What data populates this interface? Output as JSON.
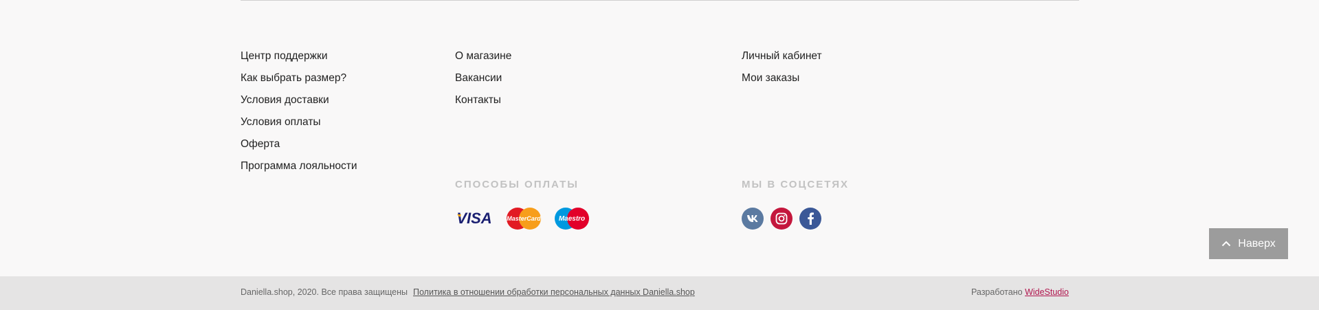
{
  "footer": {
    "column1": [
      {
        "label": "Центр поддержки"
      },
      {
        "label": "Как выбрать размер?"
      },
      {
        "label": "Условия доставки"
      },
      {
        "label": "Условия оплаты"
      },
      {
        "label": "Оферта"
      },
      {
        "label": "Программа лояльности"
      }
    ],
    "column2": [
      {
        "label": "О магазине"
      },
      {
        "label": "Вакансии"
      },
      {
        "label": "Контакты"
      }
    ],
    "column3": [
      {
        "label": "Личный кабинет"
      },
      {
        "label": "Мои заказы"
      }
    ],
    "payments": {
      "title": "СПОСОБЫ ОПЛАТЫ",
      "logos": [
        {
          "icon": "visa-logo",
          "text": "VISA"
        },
        {
          "icon": "mastercard-logo",
          "text": "MasterCard"
        },
        {
          "icon": "maestro-logo",
          "text": "Maestro"
        }
      ]
    },
    "social": {
      "title": "МЫ В СОЦСЕТЯХ",
      "items": [
        {
          "icon": "vk-icon",
          "color": "#5b7aa1"
        },
        {
          "icon": "instagram-icon",
          "color": "#c4173d"
        },
        {
          "icon": "facebook-icon",
          "color": "#3b5897"
        }
      ]
    },
    "to_top_button": {
      "label": "Наверх",
      "icon": "chevron-up-icon"
    }
  },
  "bottom_bar": {
    "copyright": "Daniella.shop, 2020. Все права защищены",
    "policy_link": "Политика в отношении обработки персональных данных Daniella.shop",
    "developed_by_label": "Разработано",
    "developer_link": "WideStudio"
  },
  "colors": {
    "background": "#f9f8f8",
    "bottom_bar": "#e5e4e4",
    "section_title": "#c2c2c2",
    "top_button": "#9c9c9c",
    "developer_link": "#b0154d"
  }
}
